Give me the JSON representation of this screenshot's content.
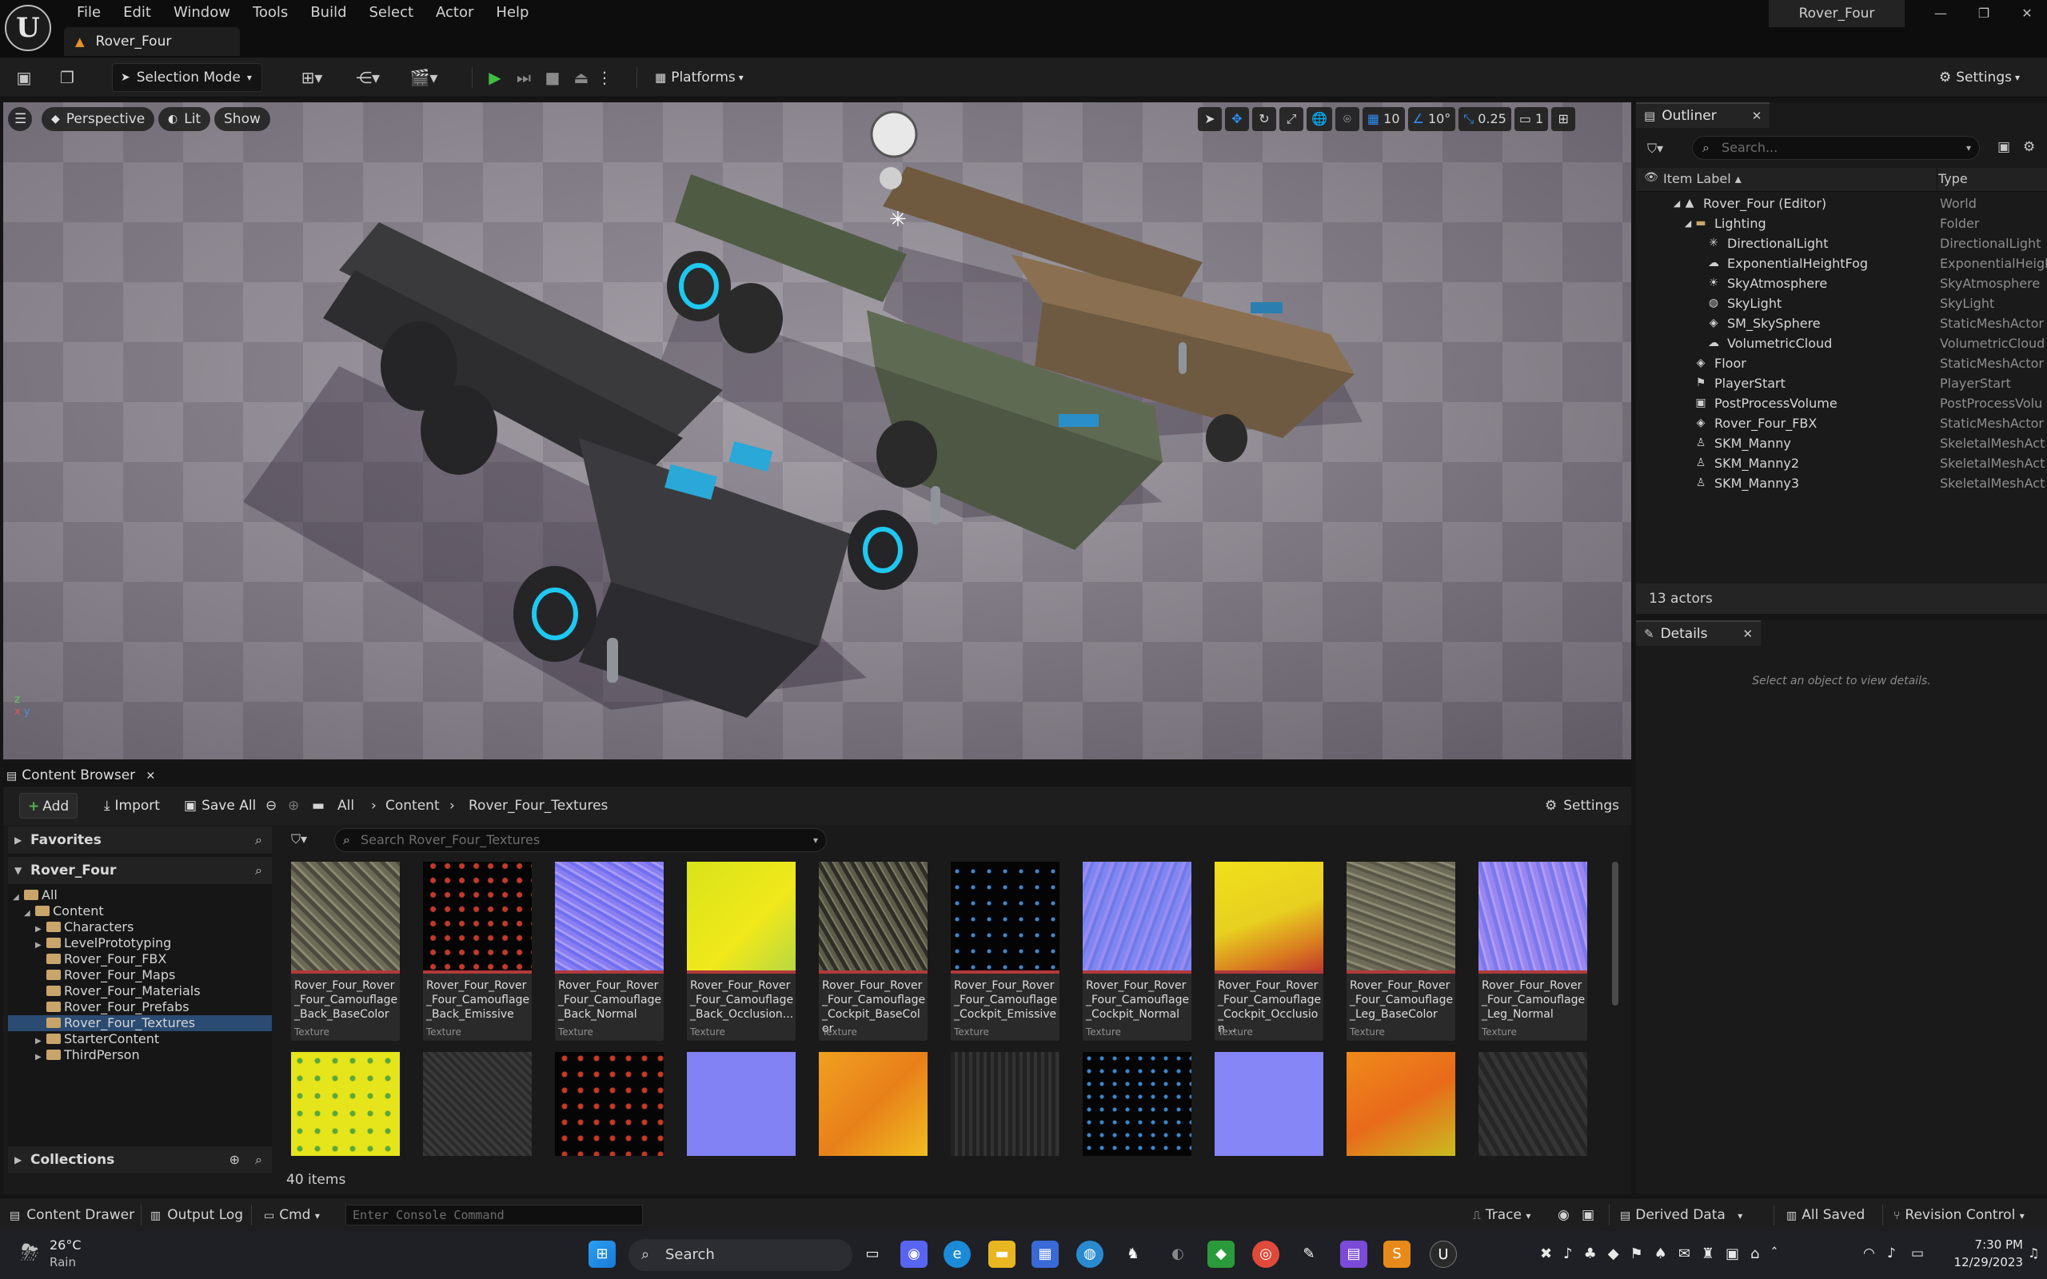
{
  "app": {
    "menu": [
      "File",
      "Edit",
      "Window",
      "Tools",
      "Build",
      "Select",
      "Actor",
      "Help"
    ],
    "doc_tab": "Rover_Four",
    "window_title": "Rover_Four"
  },
  "toolbar": {
    "selection_mode": "Selection Mode",
    "platforms": "Platforms",
    "settings": "Settings"
  },
  "viewport": {
    "perspective": "Perspective",
    "lit": "Lit",
    "show": "Show",
    "grid_snap": "10",
    "rotate_snap": "10°",
    "scale_snap": "0.25",
    "camera_speed": "1"
  },
  "outliner": {
    "tab": "Outliner",
    "search_placeholder": "Search...",
    "col_label": "Item Label",
    "col_type": "Type",
    "rows": [
      {
        "label": "Rover_Four (Editor)",
        "type": "World"
      },
      {
        "label": "Lighting",
        "type": "Folder"
      },
      {
        "label": "DirectionalLight",
        "type": "DirectionalLight"
      },
      {
        "label": "ExponentialHeightFog",
        "type": "ExponentialHeigh"
      },
      {
        "label": "SkyAtmosphere",
        "type": "SkyAtmosphere"
      },
      {
        "label": "SkyLight",
        "type": "SkyLight"
      },
      {
        "label": "SM_SkySphere",
        "type": "StaticMeshActor"
      },
      {
        "label": "VolumetricCloud",
        "type": "VolumetricCloud"
      },
      {
        "label": "Floor",
        "type": "StaticMeshActor"
      },
      {
        "label": "PlayerStart",
        "type": "PlayerStart"
      },
      {
        "label": "PostProcessVolume",
        "type": "PostProcessVolu"
      },
      {
        "label": "Rover_Four_FBX",
        "type": "StaticMeshActor"
      },
      {
        "label": "SKM_Manny",
        "type": "SkeletalMeshAct"
      },
      {
        "label": "SKM_Manny2",
        "type": "SkeletalMeshAct"
      },
      {
        "label": "SKM_Manny3",
        "type": "SkeletalMeshAct"
      }
    ],
    "count": "13 actors"
  },
  "details": {
    "tab": "Details",
    "empty": "Select an object to view details."
  },
  "content_browser": {
    "tab": "Content Browser",
    "add": "Add",
    "import": "Import",
    "save_all": "Save All",
    "crumbs": [
      "All",
      "Content",
      "Rover_Four_Textures"
    ],
    "settings": "Settings",
    "favorites": "Favorites",
    "root": "Rover_Four",
    "collections": "Collections",
    "search_placeholder": "Search Rover_Four_Textures",
    "tree": [
      "All",
      "Content",
      "Characters",
      "LevelPrototyping",
      "Rover_Four_FBX",
      "Rover_Four_Maps",
      "Rover_Four_Materials",
      "Rover_Four_Prefabs",
      "Rover_Four_Textures",
      "StarterContent",
      "ThirdPerson"
    ],
    "assets": [
      {
        "name": "Rover_Four_Rover_Four_Camouflage_Back_BaseColor",
        "type": "Texture"
      },
      {
        "name": "Rover_Four_Rover_Four_Camouflage_Back_Emissive",
        "type": "Texture"
      },
      {
        "name": "Rover_Four_Rover_Four_Camouflage_Back_Normal",
        "type": "Texture"
      },
      {
        "name": "Rover_Four_Rover_Four_Camouflage_Back_Occlusion...",
        "type": "Texture"
      },
      {
        "name": "Rover_Four_Rover_Four_Camouflage_Cockpit_BaseColor",
        "type": "Texture"
      },
      {
        "name": "Rover_Four_Rover_Four_Camouflage_Cockpit_Emissive",
        "type": "Texture"
      },
      {
        "name": "Rover_Four_Rover_Four_Camouflage_Cockpit_Normal",
        "type": "Texture"
      },
      {
        "name": "Rover_Four_Rover_Four_Camouflage_Cockpit_Occlusion...",
        "type": "Texture"
      },
      {
        "name": "Rover_Four_Rover_Four_Camouflage_Leg_BaseColor",
        "type": "Texture"
      },
      {
        "name": "Rover_Four_Rover_Four_Camouflage_Leg_Normal",
        "type": "Texture"
      }
    ],
    "item_count": "40 items"
  },
  "statusbar": {
    "content_drawer": "Content Drawer",
    "output_log": "Output Log",
    "cmd": "Cmd",
    "console_placeholder": "Enter Console Command",
    "trace": "Trace",
    "derived_data": "Derived Data",
    "all_saved": "All Saved",
    "revision_control": "Revision Control"
  },
  "taskbar": {
    "temp": "26°C",
    "weather": "Rain",
    "search": "Search",
    "time": "7:30 PM",
    "date": "12/29/2023"
  },
  "colors": {
    "accent": "#2d8ef0",
    "selection": "#2a4b72",
    "play_green": "#3fbf3f",
    "texture_bar": "#b23a3a"
  }
}
